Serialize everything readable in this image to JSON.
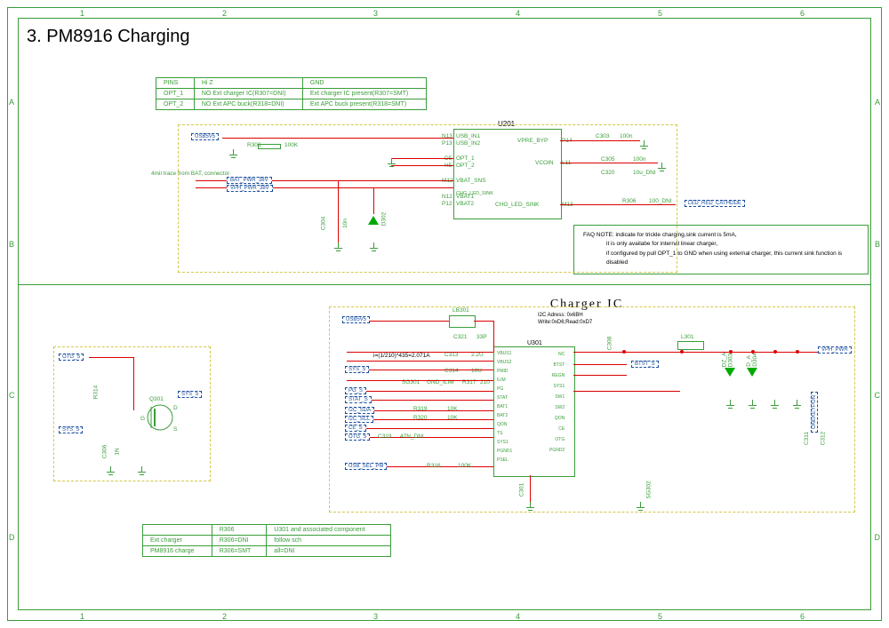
{
  "title": "3. PM8916 Charging",
  "border": {
    "cols": [
      "1",
      "2",
      "3",
      "4",
      "5",
      "6"
    ],
    "rows": [
      "A",
      "B",
      "C",
      "D"
    ]
  },
  "opt_table": {
    "headers": [
      "PINS",
      "Hi Z",
      "GND"
    ],
    "rows": [
      [
        "OPT_1",
        "NO Ext charger IC(R307=DNI)",
        "Ext charger IC present(R307=SMT)"
      ],
      [
        "OPT_2",
        "NO Ext APC buck(R318=DNI)",
        "Ext APC buck present(R318=SMT)"
      ]
    ]
  },
  "bat_note": "4mil trace from BAT, connector",
  "u201": {
    "ref": "U201",
    "left_pins": [
      {
        "pin": "N13",
        "name": "USB_IN1"
      },
      {
        "pin": "P13",
        "name": "USB_IN2"
      },
      {
        "pin": "D5",
        "name": "OPT_1"
      },
      {
        "pin": "H5",
        "name": "OPT_2"
      },
      {
        "pin": "M12",
        "name": "VBAT_SNS"
      },
      {
        "pin": "N12",
        "name": "VBAT1"
      },
      {
        "pin": "P12",
        "name": "VBAT2"
      }
    ],
    "right_pins": [
      {
        "pin": "P14",
        "name": "VPRE_BYP"
      },
      {
        "pin": "L11",
        "name": "VCOIN"
      },
      {
        "pin": "M13",
        "name": "CHG_LED_SINK"
      }
    ],
    "inner": "CHG_LED_SINK"
  },
  "top_components": {
    "r303": {
      "ref": "R303",
      "val": "100K"
    },
    "c303": {
      "ref": "C303",
      "val": "100n"
    },
    "c305": {
      "ref": "C305",
      "val": "100n"
    },
    "c320": {
      "ref": "C320",
      "val": "10u_DNI"
    },
    "c304": {
      "ref": "C304",
      "val": "10n"
    },
    "d302": {
      "ref": "D302"
    },
    "r306": {
      "ref": "R306",
      "val": "100_DNI"
    },
    "nets": {
      "vph": "BAT_PWR_38V",
      "vph2": "VPH_PWR_38V",
      "led": "LED_RED_CATHODE",
      "usbin": "USB5V5"
    }
  },
  "faq": {
    "l1": "FAQ NOTE: indicate for trickle charging,sink current is 5mA,",
    "l2": "it is only availabe for internal linear charger,",
    "l3": "if configured by pull OPT_1 to GND when using external charger, this current sink function is disabled"
  },
  "charger_ic_title": "Charger IC",
  "charger_subtitle": {
    "l1": "I2C Adress: 0x6BH",
    "l2": "Write:0xD6;Read:0xD7"
  },
  "u301": {
    "ref": "U301",
    "pins_left": [
      "VBUS1",
      "VBUS2",
      "PMID",
      "ILIM",
      "PG",
      "STAT",
      "BAT1",
      "BAT2",
      "QON",
      "TS",
      "SYS1",
      "PGND1",
      "PSEL"
    ],
    "pins_right": [
      "NC",
      "BTST",
      "REGN",
      "SYS1",
      "SW1",
      "SW2",
      "QON",
      "CE",
      "OTG",
      "PGND2"
    ]
  },
  "bottom_components": {
    "lb301": "LB301",
    "c321": {
      "ref": "C321",
      "val": "33P"
    },
    "c313": {
      "ref": "C313",
      "val": "2.2U"
    },
    "c314": {
      "ref": "C314",
      "val": "10U"
    },
    "sg301": {
      "ref": "SG301",
      "val": "GND_ILIM"
    },
    "r317": {
      "ref": "R317",
      "val": "210"
    },
    "r319": {
      "ref": "R319",
      "val": "10K"
    },
    "r320": {
      "ref": "R320",
      "val": "10K"
    },
    "r316": {
      "ref": "R316",
      "val": "100K"
    },
    "c319": {
      "ref": "C319",
      "val": "47N_DNI"
    },
    "c308": "C308",
    "l301": "L301",
    "c301": "C301",
    "c311": "C311",
    "c312": "C312",
    "sg302": "SG302",
    "d303": "DZ_A\nD303",
    "d304": "D_A\nD304",
    "q301": {
      "ref": "Q301",
      "g": "G",
      "d": "D",
      "s": "S"
    },
    "r314": "R314",
    "c306": {
      "ref": "C306",
      "val": "1N"
    },
    "calc": "i=(1/210)*435=2.071A",
    "nets": {
      "usb5v": "USB5V5",
      "gnd": "GND",
      "pg": "PG_S",
      "stat": "STAT_S",
      "sda": "I2C_SDA",
      "scl": "I2C_SCL",
      "ce": "CE_S",
      "otg": "OTG_S",
      "sys": "SYS_S",
      "psel": "USB_SEL_PM",
      "otg2": "OTG_S",
      "vph": "VPH_PWR",
      "btst": "BTST_S",
      "onekeypon": "ONEKEYPON"
    }
  },
  "dni_table": {
    "headers": [
      "",
      "R306",
      "U301 and associated component"
    ],
    "rows": [
      [
        "Ext charger",
        "R306=DNI",
        "follow sch"
      ],
      [
        "PM8916 charge",
        "R306=SMT",
        "all=DNI"
      ]
    ]
  }
}
